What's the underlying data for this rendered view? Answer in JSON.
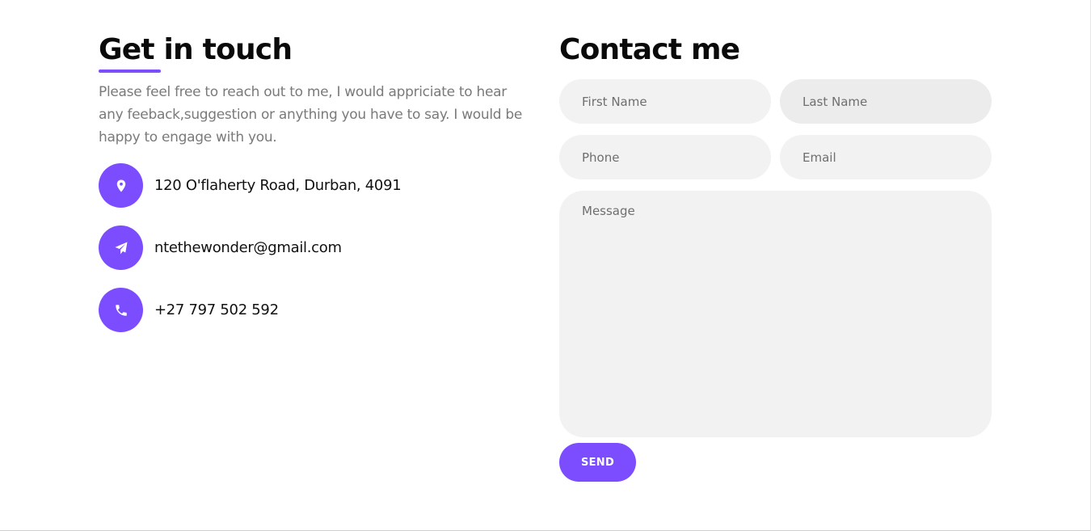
{
  "left": {
    "heading": "Get in touch",
    "intro": "Please feel free to reach out to me, I would appriciate to hear any feeback,suggestion or anything you have to say. I would be happy to engage with you.",
    "info": [
      {
        "icon": "location-pin-icon",
        "text": "120 O'flaherty Road, Durban, 4091"
      },
      {
        "icon": "paper-plane-icon",
        "text": "ntethewonder@gmail.com"
      },
      {
        "icon": "phone-icon",
        "text": "+27 797 502 592"
      }
    ]
  },
  "right": {
    "heading": "Contact me",
    "form": {
      "first_name_placeholder": "First Name",
      "last_name_placeholder": "Last Name",
      "phone_placeholder": "Phone",
      "email_placeholder": "Email",
      "message_placeholder": "Message",
      "send_label": "SEND"
    }
  },
  "colors": {
    "accent": "#7c4dff",
    "field_bg": "#f2f2f2",
    "heading": "#0a0a0a",
    "muted_text": "#7a7a7a"
  }
}
